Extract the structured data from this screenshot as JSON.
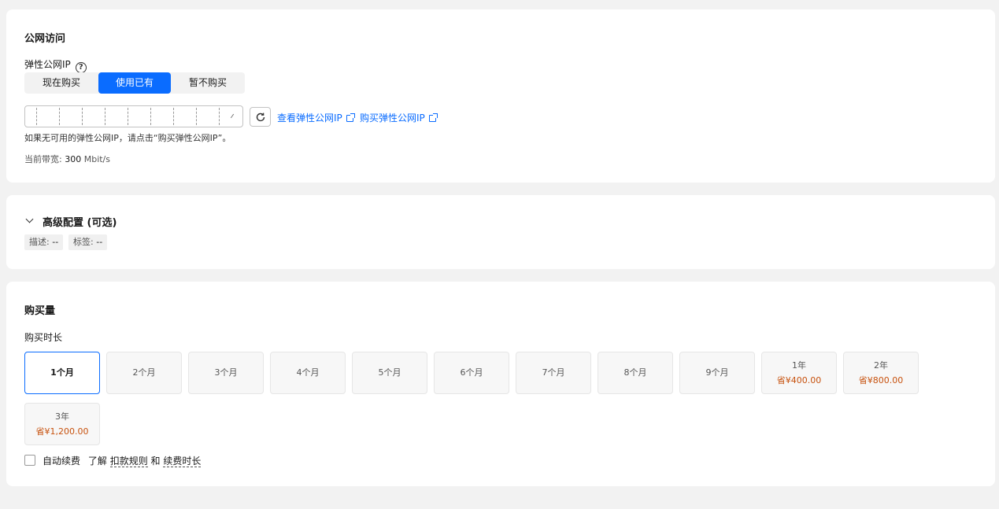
{
  "public_access": {
    "title": "公网访问",
    "eip_label": "弹性公网IP",
    "help_icon": "?",
    "options": [
      "现在购买",
      "使用已有",
      "暂不购买"
    ],
    "selected_option": "使用已有",
    "view_link": "查看弹性公网IP",
    "buy_link": "购买弹性公网IP",
    "hint": "如果无可用的弹性公网IP，请点击“购买弹性公网IP”。",
    "bandwidth_label": "当前带宽:",
    "bandwidth_value": "300",
    "bandwidth_unit": "Mbit/s"
  },
  "advanced": {
    "title": "高级配置 (可选)",
    "desc_label": "描述:",
    "desc_value": "--",
    "tag_label": "标签:",
    "tag_value": "--"
  },
  "purchase": {
    "title": "购买量",
    "duration_label": "购买时长",
    "selected": "1个月",
    "durations": [
      {
        "label": "1个月",
        "save": ""
      },
      {
        "label": "2个月",
        "save": ""
      },
      {
        "label": "3个月",
        "save": ""
      },
      {
        "label": "4个月",
        "save": ""
      },
      {
        "label": "5个月",
        "save": ""
      },
      {
        "label": "6个月",
        "save": ""
      },
      {
        "label": "7个月",
        "save": ""
      },
      {
        "label": "8个月",
        "save": ""
      },
      {
        "label": "9个月",
        "save": ""
      },
      {
        "label": "1年",
        "save": "省¥400.00"
      },
      {
        "label": "2年",
        "save": "省¥800.00"
      },
      {
        "label": "3年",
        "save": "省¥1,200.00"
      }
    ],
    "auto_renew_label": "自动续费",
    "learn_text": "了解",
    "deduction_rules": "扣款规则",
    "and_text": "和",
    "renewal_duration": "续费时长"
  },
  "colors": {
    "accent": "#0a6cff",
    "saving": "#c7510d",
    "background": "#f2f2f2"
  }
}
